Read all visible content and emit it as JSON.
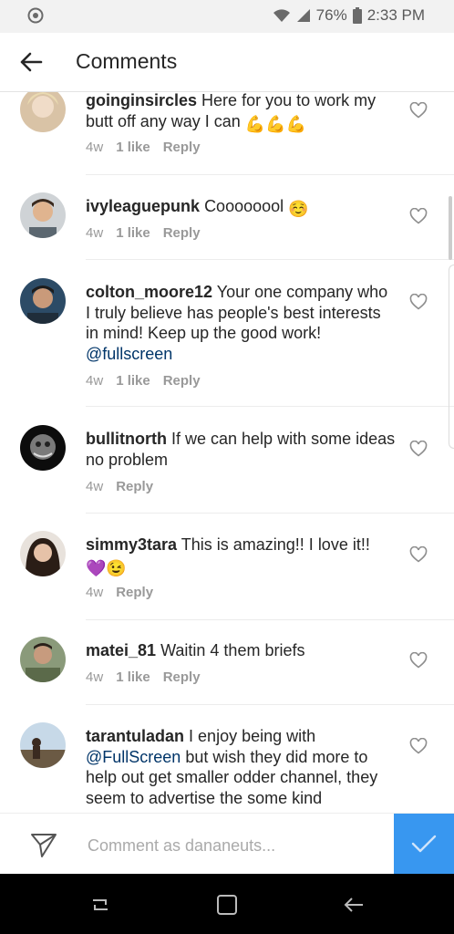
{
  "status_bar": {
    "battery": "76%",
    "time": "2:33 PM"
  },
  "header": {
    "title": "Comments"
  },
  "comments": [
    {
      "username": "goinginsircles",
      "text": "Here for you to work my butt off any way I can",
      "emoji": "💪💪💪",
      "time": "4w",
      "likes": "1 like",
      "reply": "Reply"
    },
    {
      "username": "ivyleaguepunk",
      "text": "Coooooool",
      "emoji": "☺️",
      "time": "4w",
      "likes": "1 like",
      "reply": "Reply"
    },
    {
      "username": "colton_moore12",
      "text": "Your one company who I truly believe has people's best interests in mind! Keep up the good work!",
      "mention": "@fullscreen",
      "time": "4w",
      "likes": "1 like",
      "reply": "Reply"
    },
    {
      "username": "bullitnorth",
      "text": "If we can help with some ideas no problem",
      "time": "4w",
      "reply": "Reply"
    },
    {
      "username": "simmy3tara",
      "text": "This is amazing!! I love it!!",
      "emoji": "💜😉",
      "time": "4w",
      "reply": "Reply"
    },
    {
      "username": "matei_81",
      "text": "Waitin 4 them briefs",
      "time": "4w",
      "likes": "1 like",
      "reply": "Reply"
    },
    {
      "username": "tarantuladan",
      "text": "I enjoy being with",
      "mention": "@FullScreen",
      "text_after": "but wish they did more to help out get smaller odder channel, they seem to advertise the some kind"
    }
  ],
  "composer": {
    "placeholder": "Comment as dananeuts..."
  },
  "colors": {
    "accent": "#3897f0",
    "mention": "#003569",
    "meta": "#999999"
  }
}
